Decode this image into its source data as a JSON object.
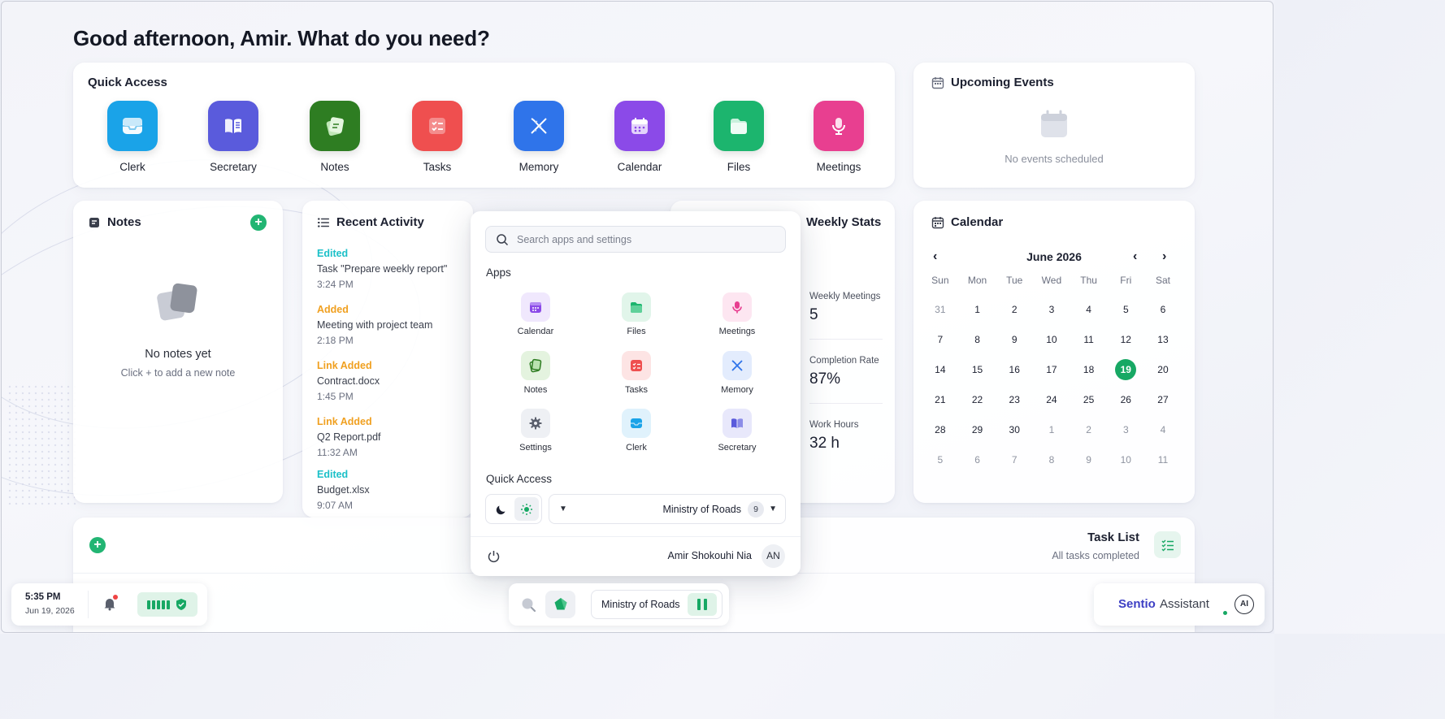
{
  "greeting": "Good afternoon, Amir. What do you need?",
  "quick_access": {
    "title": "Quick Access",
    "items": [
      {
        "label": "Clerk",
        "icon": "inbox-icon",
        "color": "#1aa3e8"
      },
      {
        "label": "Secretary",
        "icon": "book-icon",
        "color": "#5a5bdc"
      },
      {
        "label": "Notes",
        "icon": "notes-icon",
        "color": "#2e7d22"
      },
      {
        "label": "Tasks",
        "icon": "checklist-icon",
        "color": "#ef4f4f"
      },
      {
        "label": "Memory",
        "icon": "dna-icon",
        "color": "#2f74ea"
      },
      {
        "label": "Calendar",
        "icon": "calendar-icon",
        "color": "#8b4ae8"
      },
      {
        "label": "Files",
        "icon": "folder-icon",
        "color": "#1cb56e"
      },
      {
        "label": "Meetings",
        "icon": "microphone-icon",
        "color": "#e83f90"
      }
    ]
  },
  "upcoming_events": {
    "title": "Upcoming Events",
    "empty_text": "No events scheduled"
  },
  "notes": {
    "title": "Notes",
    "add_label": "+",
    "empty_title": "No notes yet",
    "empty_hint": "Click + to add a new note"
  },
  "recent_activity": {
    "title": "Recent Activity",
    "items": [
      {
        "kind": "Edited",
        "desc": "Task \"Prepare weekly report\"",
        "time": "3:24 PM",
        "color": "#1cc0c8"
      },
      {
        "kind": "Added",
        "desc": "Meeting with project team",
        "time": "2:18 PM",
        "color": "#f0a020"
      },
      {
        "kind": "Link Added",
        "desc": "Contract.docx",
        "time": "1:45 PM",
        "color": "#f0a020"
      },
      {
        "kind": "Link Added",
        "desc": "Q2 Report.pdf",
        "time": "11:32 AM",
        "color": "#f0a020"
      },
      {
        "kind": "Edited",
        "desc": "Budget.xlsx",
        "time": "9:07 AM",
        "color": "#1cc0c8"
      }
    ]
  },
  "weekly_stats": {
    "title": "Weekly Stats",
    "stats": [
      {
        "label": "Weekly Meetings",
        "value": "5"
      },
      {
        "label": "Completion Rate",
        "value": "87%"
      },
      {
        "label": "Work Hours",
        "value": "32 h"
      }
    ]
  },
  "calendar": {
    "title": "Calendar",
    "month": "June 2026",
    "prev": "‹",
    "next": "›",
    "days_of_week": [
      "Sun",
      "Mon",
      "Tue",
      "Wed",
      "Thu",
      "Fri",
      "Sat"
    ],
    "weeks": [
      [
        "31",
        "1",
        "2",
        "3",
        "4",
        "5",
        "6"
      ],
      [
        "7",
        "8",
        "9",
        "10",
        "11",
        "12",
        "13"
      ],
      [
        "14",
        "15",
        "16",
        "17",
        "18",
        "19",
        "20"
      ],
      [
        "21",
        "22",
        "23",
        "24",
        "25",
        "26",
        "27"
      ],
      [
        "28",
        "29",
        "30",
        "1",
        "2",
        "3",
        "4"
      ],
      [
        "5",
        "6",
        "7",
        "8",
        "9",
        "10",
        "11"
      ]
    ],
    "today": "19",
    "accent": "#17a864"
  },
  "task_list": {
    "title": "Task List",
    "subtitle": "All tasks completed",
    "add_label": "+"
  },
  "launcher": {
    "search_placeholder": "Search apps and settings",
    "apps_title": "Apps",
    "apps": [
      {
        "label": "Calendar",
        "icon": "calendar-icon"
      },
      {
        "label": "Files",
        "icon": "folder-icon"
      },
      {
        "label": "Meetings",
        "icon": "microphone-icon"
      },
      {
        "label": "Notes",
        "icon": "notes-icon"
      },
      {
        "label": "Tasks",
        "icon": "checklist-icon"
      },
      {
        "label": "Memory",
        "icon": "dna-icon"
      },
      {
        "label": "Settings",
        "icon": "gear-icon"
      },
      {
        "label": "Clerk",
        "icon": "inbox-icon"
      },
      {
        "label": "Secretary",
        "icon": "book-icon"
      }
    ],
    "quick_access_title": "Quick Access",
    "organization": "Ministry of Roads",
    "organization_count": "9",
    "user_name": "Amir Shokouhi Nia",
    "user_initials": "AN"
  },
  "taskbar": {
    "time": "5:35 PM",
    "date": "Jun 19, 2026",
    "organization": "Ministry of Roads",
    "assistant_brand": "Sentio",
    "assistant_word": "Assistant",
    "ai_label": "AI"
  }
}
